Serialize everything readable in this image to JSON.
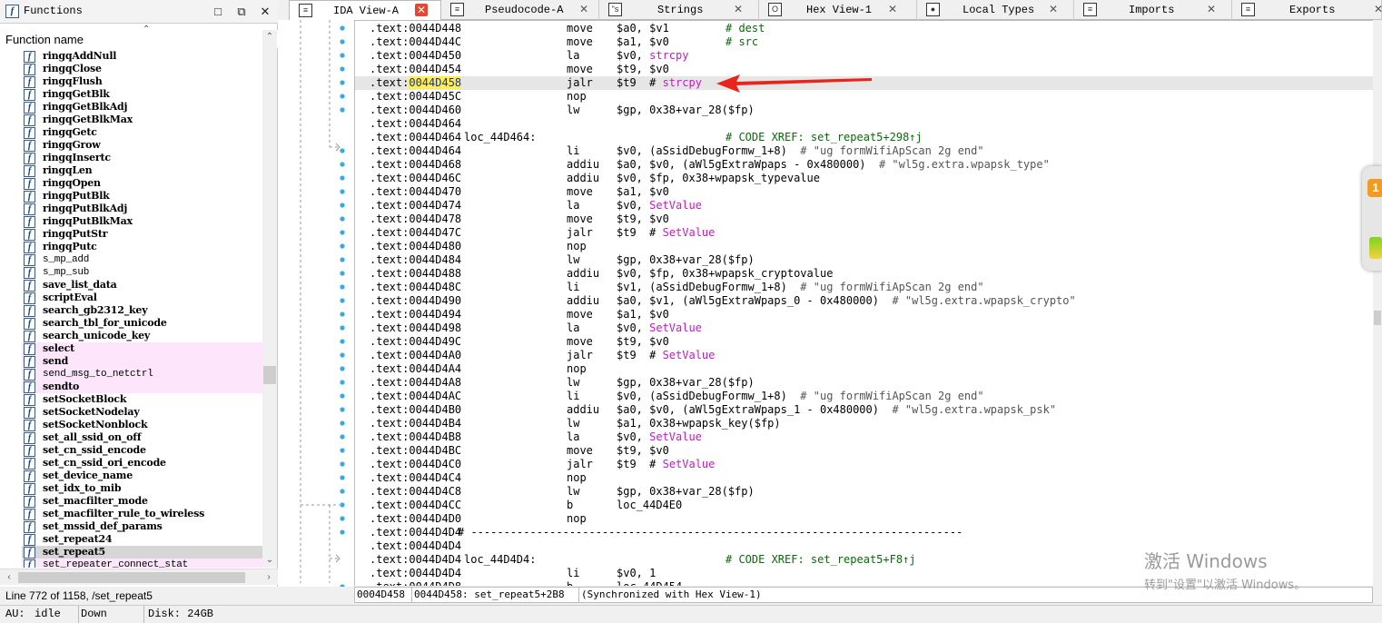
{
  "functions_panel": {
    "title": "Functions",
    "column_header": "Function name",
    "status": "Line 772 of 1158, /set_repeat5",
    "items": [
      {
        "name": "ringqAddNull",
        "style": "bold"
      },
      {
        "name": "ringqClose",
        "style": "bold"
      },
      {
        "name": "ringqFlush",
        "style": "bold"
      },
      {
        "name": "ringqGetBlk",
        "style": "bold"
      },
      {
        "name": "ringqGetBlkAdj",
        "style": "bold"
      },
      {
        "name": "ringqGetBlkMax",
        "style": "bold"
      },
      {
        "name": "ringqGetc",
        "style": "bold"
      },
      {
        "name": "ringqGrow",
        "style": "bold"
      },
      {
        "name": "ringqInsertc",
        "style": "bold"
      },
      {
        "name": "ringqLen",
        "style": "bold"
      },
      {
        "name": "ringqOpen",
        "style": "bold"
      },
      {
        "name": "ringqPutBlk",
        "style": "bold"
      },
      {
        "name": "ringqPutBlkAdj",
        "style": "bold"
      },
      {
        "name": "ringqPutBlkMax",
        "style": "bold"
      },
      {
        "name": "ringqPutStr",
        "style": "bold"
      },
      {
        "name": "ringqPutc",
        "style": "bold"
      },
      {
        "name": "s_mp_add",
        "style": "thin"
      },
      {
        "name": "s_mp_sub",
        "style": "thin"
      },
      {
        "name": "save_list_data",
        "style": "bold"
      },
      {
        "name": "scriptEval",
        "style": "bold"
      },
      {
        "name": "search_gb2312_key",
        "style": "bold"
      },
      {
        "name": "search_tbl_for_unicode",
        "style": "bold"
      },
      {
        "name": "search_unicode_key",
        "style": "bold"
      },
      {
        "name": "select",
        "style": "bold",
        "bg": "pink"
      },
      {
        "name": "send",
        "style": "bold",
        "bg": "pink"
      },
      {
        "name": "send_msg_to_netctrl",
        "style": "thin",
        "bg": "pink"
      },
      {
        "name": "sendto",
        "style": "bold",
        "bg": "pink"
      },
      {
        "name": "setSocketBlock",
        "style": "bold"
      },
      {
        "name": "setSocketNodelay",
        "style": "bold"
      },
      {
        "name": "setSocketNonblock",
        "style": "bold"
      },
      {
        "name": "set_all_ssid_on_off",
        "style": "bold"
      },
      {
        "name": "set_cn_ssid_encode",
        "style": "bold"
      },
      {
        "name": "set_cn_ssid_ori_encode",
        "style": "bold"
      },
      {
        "name": "set_device_name",
        "style": "bold"
      },
      {
        "name": "set_idx_to_mib",
        "style": "bold"
      },
      {
        "name": "set_macfilter_mode",
        "style": "bold"
      },
      {
        "name": "set_macfilter_rule_to_wireless",
        "style": "bold"
      },
      {
        "name": "set_mssid_def_params",
        "style": "bold"
      },
      {
        "name": "set_repeat24",
        "style": "bold"
      },
      {
        "name": "set_repeat5",
        "style": "bold",
        "bg": "sel"
      },
      {
        "name": "set_repeater_connect_stat",
        "style": "thin",
        "bg": "pink"
      }
    ]
  },
  "tabs": [
    {
      "label": "IDA View-A",
      "icon": "ida-view-icon",
      "glyph": "≡",
      "active": true
    },
    {
      "label": "Pseudocode-A",
      "icon": "pseudocode-icon",
      "glyph": "≡",
      "active": false
    },
    {
      "label": "Strings",
      "icon": "strings-icon",
      "glyph": "\"s",
      "active": false
    },
    {
      "label": "Hex View-1",
      "icon": "hex-view-icon",
      "glyph": "O",
      "active": false
    },
    {
      "label": "Local Types",
      "icon": "local-types-icon",
      "glyph": "●",
      "active": false
    },
    {
      "label": "Imports",
      "icon": "imports-icon",
      "glyph": "≡",
      "active": false
    },
    {
      "label": "Exports",
      "icon": "exports-icon",
      "glyph": "≡",
      "active": false
    }
  ],
  "code_lines": [
    {
      "addr": ".text:0044D448",
      "label": "",
      "mn": "move",
      "op": "$a0, $v1",
      "cm": "# dest",
      "cmx": 408
    },
    {
      "addr": ".text:0044D44C",
      "label": "",
      "mn": "move",
      "op": "$a1, $v0",
      "cm": "# src",
      "cmx": 408
    },
    {
      "addr": ".text:0044D450",
      "label": "",
      "mn": "la",
      "op": "$v0, ",
      "pk": "strcpy",
      "cm": ""
    },
    {
      "addr": ".text:0044D454",
      "label": "",
      "mn": "move",
      "op": "$t9, $v0",
      "cm": ""
    },
    {
      "addr": ".text:0044D458",
      "label": "",
      "mn": "jalr",
      "op": "$t9  # ",
      "pk": "strcpy",
      "cm": "",
      "hl": true,
      "addrhl": "0044D458"
    },
    {
      "addr": ".text:0044D45C",
      "label": "",
      "mn": "nop",
      "op": "",
      "cm": ""
    },
    {
      "addr": ".text:0044D460",
      "label": "",
      "mn": "lw",
      "op": "$gp, 0x38+var_28($fp)",
      "cm": ""
    },
    {
      "addr": ".text:0044D464",
      "label": "",
      "mn": "",
      "op": "",
      "cm": ""
    },
    {
      "addr": ".text:0044D464",
      "label": "loc_44D464:",
      "mn": "",
      "op": "",
      "cm": "# CODE XREF: set_repeat5+298↑j",
      "cmx": 408
    },
    {
      "addr": ".text:0044D464",
      "label": "",
      "mn": "li",
      "op": "$v0, (aSsidDebugFormw_1+8)  ",
      "cm": "# \"ug formWifiApScan 2g end\"",
      "inl": true
    },
    {
      "addr": ".text:0044D468",
      "label": "",
      "mn": "addiu",
      "op": "$a0, $v0, (aWl5gExtraWpaps - 0x480000)  ",
      "cm": "# \"wl5g.extra.wpapsk_type\"",
      "inl": true
    },
    {
      "addr": ".text:0044D46C",
      "label": "",
      "mn": "addiu",
      "op": "$v0, $fp, 0x38+wpapsk_typevalue",
      "cm": ""
    },
    {
      "addr": ".text:0044D470",
      "label": "",
      "mn": "move",
      "op": "$a1, $v0",
      "cm": ""
    },
    {
      "addr": ".text:0044D474",
      "label": "",
      "mn": "la",
      "op": "$v0, ",
      "pk": "SetValue",
      "cm": ""
    },
    {
      "addr": ".text:0044D478",
      "label": "",
      "mn": "move",
      "op": "$t9, $v0",
      "cm": ""
    },
    {
      "addr": ".text:0044D47C",
      "label": "",
      "mn": "jalr",
      "op": "$t9  # ",
      "pk": "SetValue",
      "cm": ""
    },
    {
      "addr": ".text:0044D480",
      "label": "",
      "mn": "nop",
      "op": "",
      "cm": ""
    },
    {
      "addr": ".text:0044D484",
      "label": "",
      "mn": "lw",
      "op": "$gp, 0x38+var_28($fp)",
      "cm": ""
    },
    {
      "addr": ".text:0044D488",
      "label": "",
      "mn": "addiu",
      "op": "$v0, $fp, 0x38+wpapsk_cryptovalue",
      "cm": ""
    },
    {
      "addr": ".text:0044D48C",
      "label": "",
      "mn": "li",
      "op": "$v1, (aSsidDebugFormw_1+8)  ",
      "cm": "# \"ug formWifiApScan 2g end\"",
      "inl": true
    },
    {
      "addr": ".text:0044D490",
      "label": "",
      "mn": "addiu",
      "op": "$a0, $v1, (aWl5gExtraWpaps_0 - 0x480000)  ",
      "cm": "# \"wl5g.extra.wpapsk_crypto\"",
      "inl": true
    },
    {
      "addr": ".text:0044D494",
      "label": "",
      "mn": "move",
      "op": "$a1, $v0",
      "cm": ""
    },
    {
      "addr": ".text:0044D498",
      "label": "",
      "mn": "la",
      "op": "$v0, ",
      "pk": "SetValue",
      "cm": ""
    },
    {
      "addr": ".text:0044D49C",
      "label": "",
      "mn": "move",
      "op": "$t9, $v0",
      "cm": ""
    },
    {
      "addr": ".text:0044D4A0",
      "label": "",
      "mn": "jalr",
      "op": "$t9  # ",
      "pk": "SetValue",
      "cm": ""
    },
    {
      "addr": ".text:0044D4A4",
      "label": "",
      "mn": "nop",
      "op": "",
      "cm": ""
    },
    {
      "addr": ".text:0044D4A8",
      "label": "",
      "mn": "lw",
      "op": "$gp, 0x38+var_28($fp)",
      "cm": ""
    },
    {
      "addr": ".text:0044D4AC",
      "label": "",
      "mn": "li",
      "op": "$v0, (aSsidDebugFormw_1+8)  ",
      "cm": "# \"ug formWifiApScan 2g end\"",
      "inl": true
    },
    {
      "addr": ".text:0044D4B0",
      "label": "",
      "mn": "addiu",
      "op": "$a0, $v0, (aWl5gExtraWpaps_1 - 0x480000)  ",
      "cm": "# \"wl5g.extra.wpapsk_psk\"",
      "inl": true
    },
    {
      "addr": ".text:0044D4B4",
      "label": "",
      "mn": "lw",
      "op": "$a1, 0x38+wpapsk_key($fp)",
      "cm": ""
    },
    {
      "addr": ".text:0044D4B8",
      "label": "",
      "mn": "la",
      "op": "$v0, ",
      "pk": "SetValue",
      "cm": ""
    },
    {
      "addr": ".text:0044D4BC",
      "label": "",
      "mn": "move",
      "op": "$t9, $v0",
      "cm": ""
    },
    {
      "addr": ".text:0044D4C0",
      "label": "",
      "mn": "jalr",
      "op": "$t9  # ",
      "pk": "SetValue",
      "cm": ""
    },
    {
      "addr": ".text:0044D4C4",
      "label": "",
      "mn": "nop",
      "op": "",
      "cm": ""
    },
    {
      "addr": ".text:0044D4C8",
      "label": "",
      "mn": "lw",
      "op": "$gp, 0x38+var_28($fp)",
      "cm": ""
    },
    {
      "addr": ".text:0044D4CC",
      "label": "",
      "mn": "b",
      "op": "loc_44D4E0",
      "cm": ""
    },
    {
      "addr": ".text:0044D4D0",
      "label": "",
      "mn": "nop",
      "op": "",
      "cm": ""
    },
    {
      "addr": ".text:0044D4D4",
      "label": "",
      "mn": "",
      "op": "",
      "cm": "# ---------------------------------------------------------------------------",
      "cmx": 113
    },
    {
      "addr": ".text:0044D4D4",
      "label": "",
      "mn": "",
      "op": "",
      "cm": ""
    },
    {
      "addr": ".text:0044D4D4",
      "label": "loc_44D4D4:",
      "mn": "",
      "op": "",
      "cm": "# CODE XREF: set_repeat5+F8↑j",
      "cmx": 408
    },
    {
      "addr": ".text:0044D4D4",
      "label": "",
      "mn": "li",
      "op": "$v0, 1",
      "cm": ""
    },
    {
      "addr": ".text:0044D4D8",
      "label": "",
      "mn": "b",
      "op": "loc_44D454",
      "cm": ""
    }
  ],
  "status_line": {
    "left": "0004D458",
    "right": "0044D458: set_repeat5+2B8",
    "sync": "(Synchronized with Hex View-1)"
  },
  "bottom_bar": {
    "au_label": "AU:",
    "au_value": "idle",
    "dir": "Down",
    "disk": "Disk: 24GB"
  },
  "side_widget": {
    "badge": "1"
  },
  "watermark": {
    "line1": "激活 Windows",
    "line2": "转到\"设置\"以激活 Windows。"
  },
  "colors": {
    "arrow": "#e8251c",
    "comment": "#096a09",
    "name_ref": "#c818c8",
    "gutter_dot": "#39a8e6"
  }
}
